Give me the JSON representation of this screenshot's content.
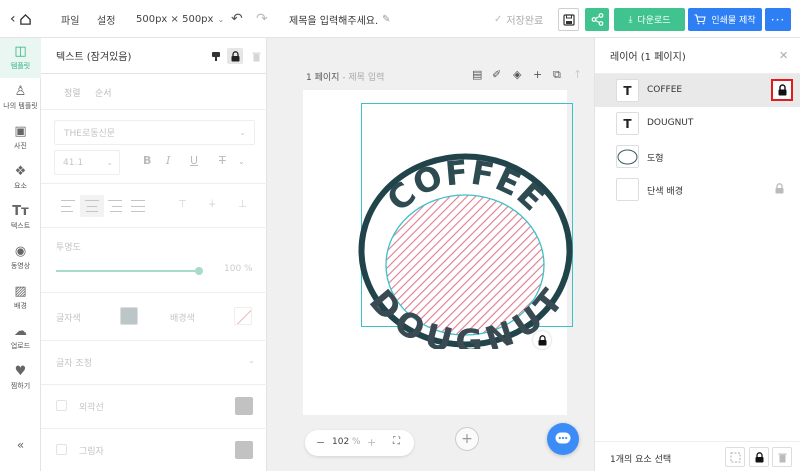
{
  "topbar": {
    "file_label": "파일",
    "settings_label": "설정",
    "size_label": "500px × 500px",
    "title_placeholder": "제목을 입력해주세요.",
    "saved_label": "저장완료",
    "download_label": "다운로드",
    "print_label": "인쇄물 제작",
    "more_label": "···"
  },
  "rail": {
    "items": [
      {
        "label": "템플릿",
        "icon": "template-icon"
      },
      {
        "label": "나의 템플릿",
        "icon": "my-template-icon"
      },
      {
        "label": "사진",
        "icon": "photo-icon"
      },
      {
        "label": "요소",
        "icon": "elements-icon"
      },
      {
        "label": "텍스트",
        "icon": "text-icon"
      },
      {
        "label": "동영상",
        "icon": "video-icon"
      },
      {
        "label": "배경",
        "icon": "background-icon"
      },
      {
        "label": "업로드",
        "icon": "upload-icon"
      },
      {
        "label": "찜하기",
        "icon": "heart-icon"
      }
    ],
    "collapse_label": "«"
  },
  "panel": {
    "title": "텍스트 (잠겨있음)",
    "tabs": [
      "정렬",
      "순서"
    ],
    "font": "THE로동신문",
    "font_size": "41.1",
    "bold_label": "B",
    "italic_label": "I",
    "underline_label": "U",
    "strike_label": "Ŧ",
    "opacity_label": "투명도",
    "opacity_value": "100 %",
    "opacity_level": 1.0,
    "text_color_label": "글자색",
    "bg_color_label": "배경색",
    "spacing_label": "글자 조정",
    "outline_label": "외곽선",
    "shadow_label": "그림자",
    "text_color": "#bcc6c9"
  },
  "canvas": {
    "page_label": "1 페이지",
    "page_sub": " - 제목 입력",
    "zoom_value": "102",
    "zoom_unit": " %",
    "art_text_top": "COFFEE",
    "art_text_bottom": "DOUGNUT",
    "colors": {
      "ring": "#21434a",
      "text": "#2e4b52",
      "hatch": "#e07b8e",
      "selection": "#3cc1c8"
    }
  },
  "layers": {
    "title": "레이어 (1 페이지)",
    "items": [
      {
        "name": "COFFEE",
        "thumb": "T",
        "locked": true
      },
      {
        "name": "DOUGNUT",
        "thumb": "T",
        "locked": false
      },
      {
        "name": "도형",
        "thumb": "ellipse",
        "locked": false
      },
      {
        "name": "단색 배경",
        "thumb": "blank",
        "locked": true
      }
    ],
    "selection_count": "1개의 요소 선택"
  },
  "accent": {
    "green": "#41c38f",
    "blue": "#2d7ff3",
    "lock_highlight": "#e01c1c"
  }
}
